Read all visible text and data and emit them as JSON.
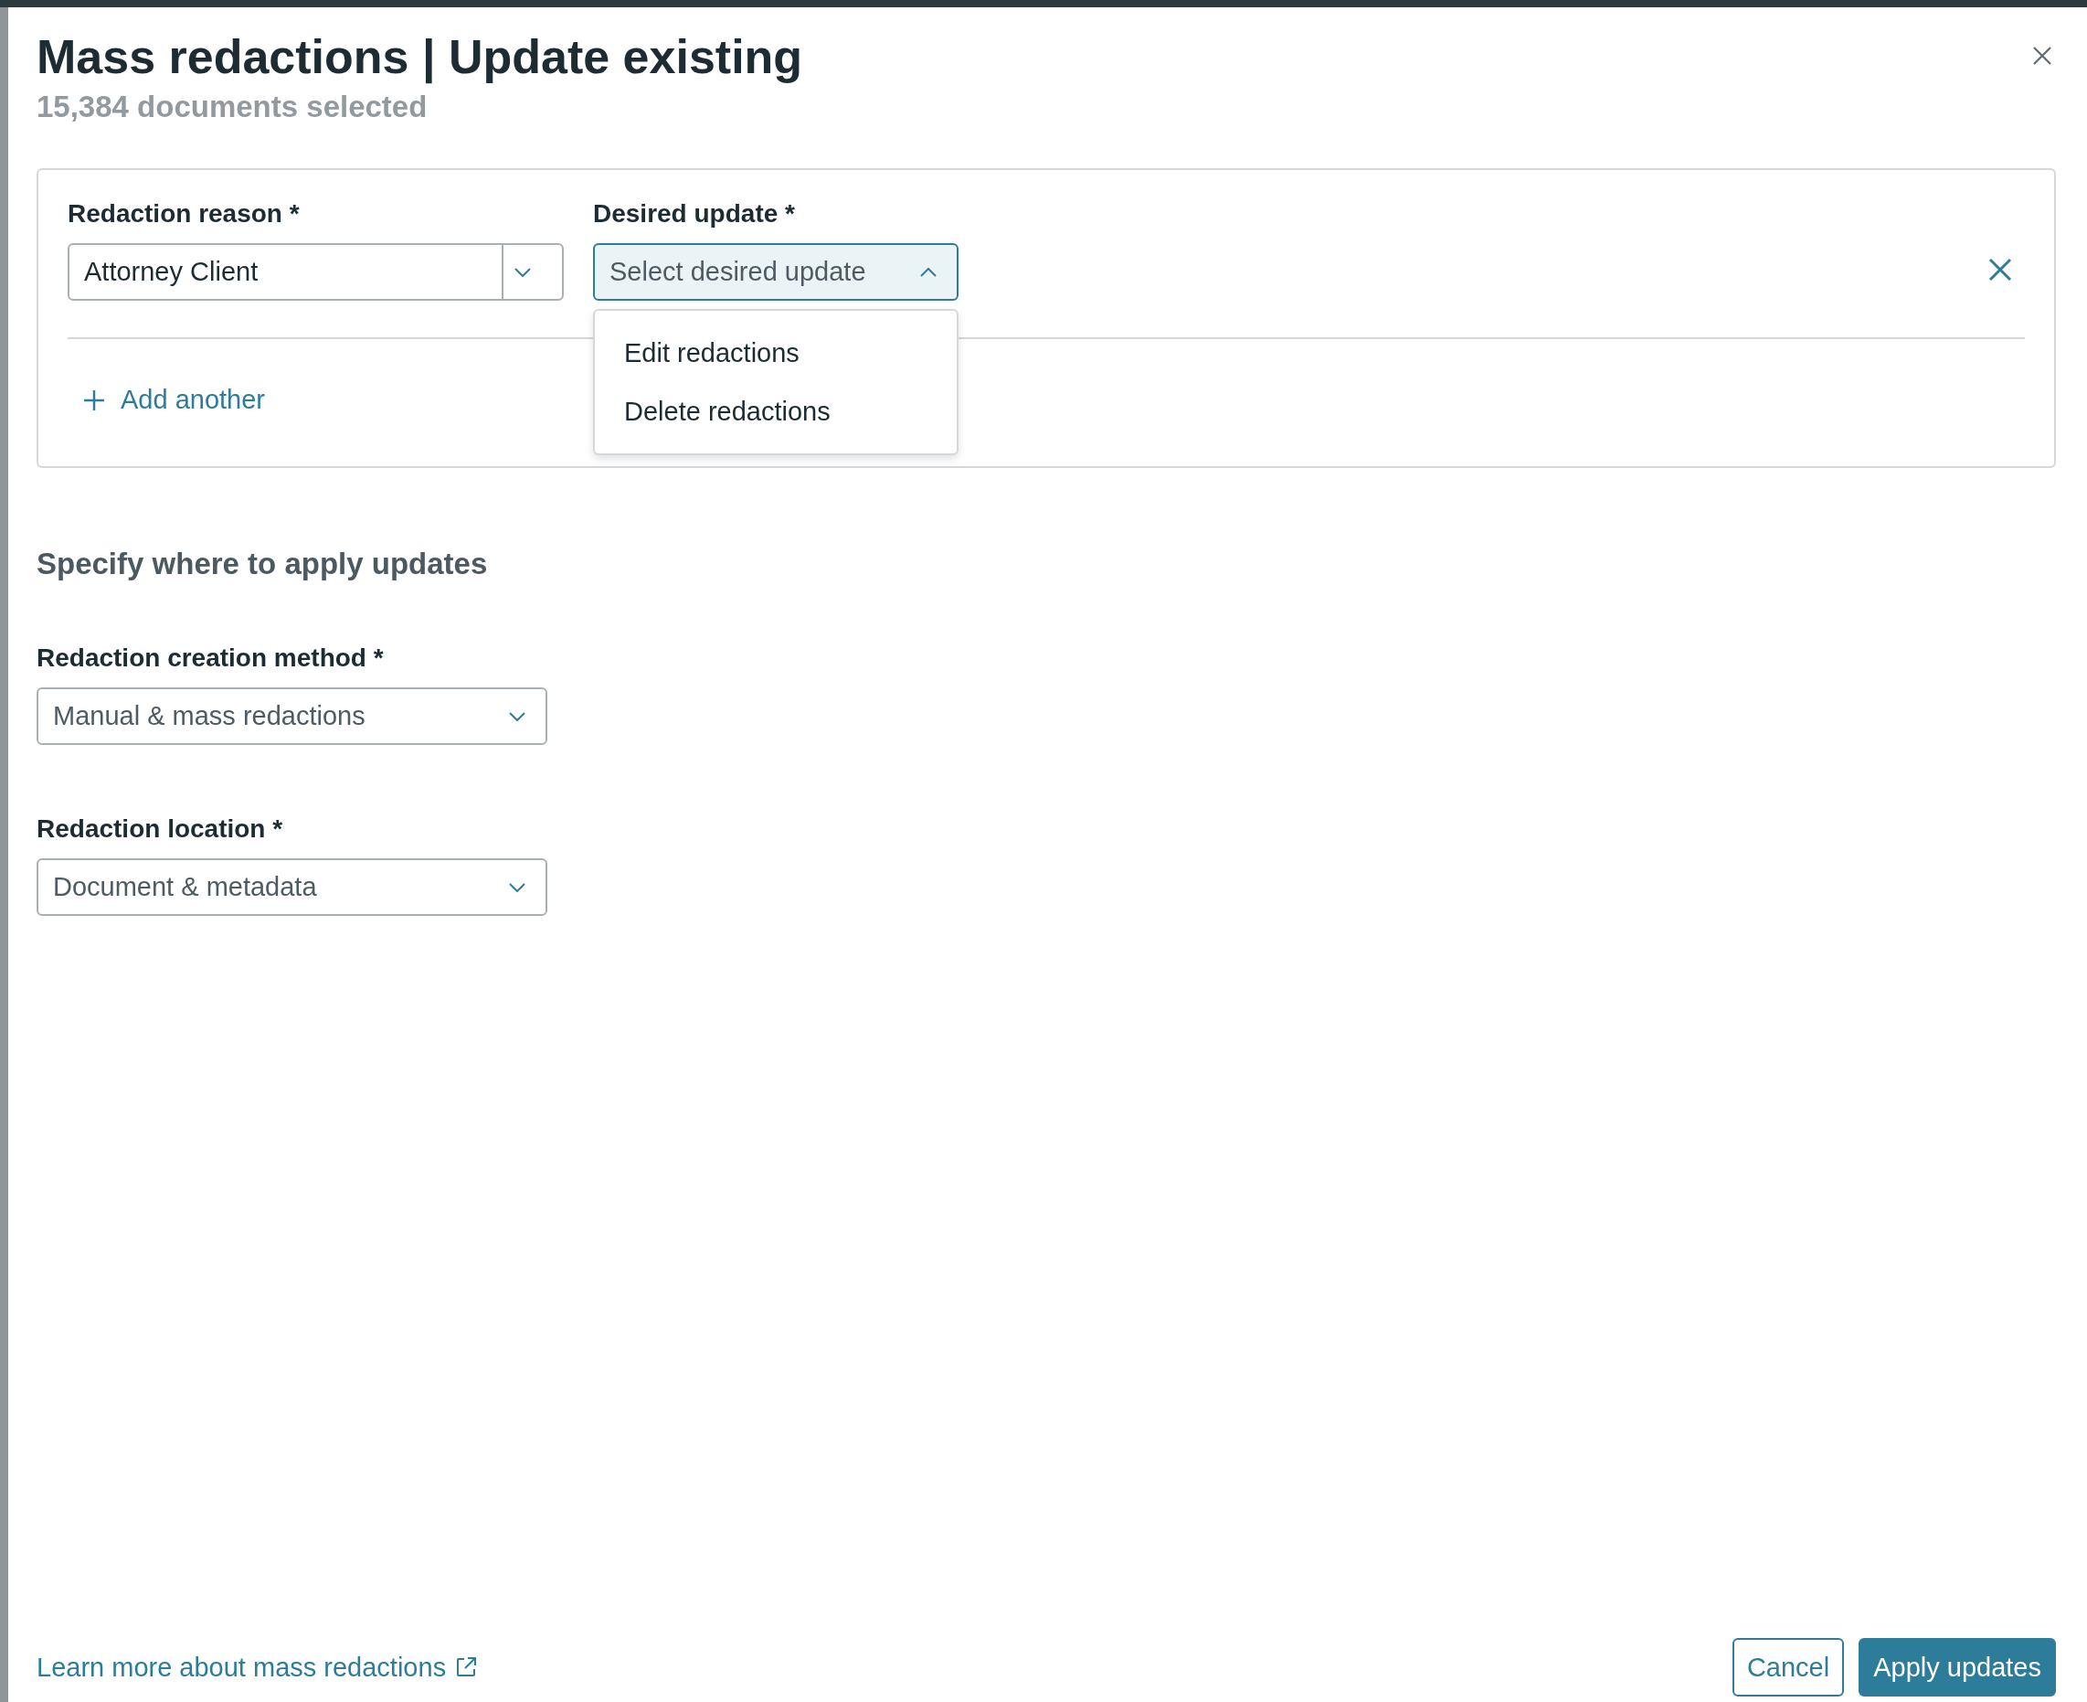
{
  "dialog": {
    "title": "Mass redactions | Update existing",
    "subtitle": "15,384 documents selected"
  },
  "rows": [
    {
      "reason": {
        "label": "Redaction reason *",
        "value": "Attorney Client"
      },
      "update": {
        "label": "Desired update *",
        "placeholder": "Select desired update",
        "expanded": true,
        "options": [
          "Edit redactions",
          "Delete redactions"
        ]
      }
    }
  ],
  "add_another": "Add another",
  "section": {
    "heading": "Specify where to apply updates",
    "fields": [
      {
        "label": "Redaction creation method *",
        "value": "Manual & mass redactions"
      },
      {
        "label": "Redaction location *",
        "value": "Document & metadata"
      }
    ]
  },
  "footer": {
    "link": "Learn more about mass redactions",
    "buttons": [
      {
        "label": "Cancel",
        "kind": "secondary"
      },
      {
        "label": "Apply updates",
        "kind": "primary"
      }
    ]
  }
}
